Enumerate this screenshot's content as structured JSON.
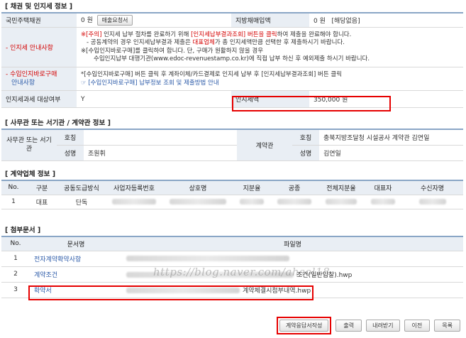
{
  "bond_section": {
    "title": "[ 채권 및 인지세 정보 ]",
    "housing_bond_label": "국민주택채권",
    "housing_bond_value": "0 원",
    "purchase_btn": "매출요청서",
    "local_bond_label": "지방채매입액",
    "local_bond_value": "0 원   [해당없음]",
    "stamp_guide_label": "- 인지세 안내사항",
    "guide_line1_prefix": "※[주의] ",
    "guide_line1_a": "인지세 납부 절차를 완료하기 위해 ",
    "guide_line1_red": "[인지세납부결과조회] 버튼을 클릭",
    "guide_line1_b": "하여 제출을 완료해야 합니다.",
    "guide_line2_a": "- 공동계약의 경우 인지세납부결과 제출은 ",
    "guide_line2_red": "대표업체",
    "guide_line2_b": "가 총 인지세액만큼 선택한 후 제출하시기 바랍니다.",
    "guide_line3": "※[수입인지바로구매]를 클릭하여 합니다. 단, 구매가 원활하지 않을 경우",
    "guide_line4": "수입인지납부 대행기관(www.edoc-revenuestamp.co.kr)에 직접 납부 하신 후 예외제출 하시기 바랍니다.",
    "buy_label_1": "- 수입인지바로구매",
    "buy_label_2": "안내사항",
    "buy_line1": "*[수입인지바로구매] 버튼 클릭 후 계좌이체/카드결제로 인지세 납부 후 [인지세납부결과조회] 버튼 클릭",
    "buy_line2": "[수입인지바로구매] 납부정보 조회 및 제출방법 안내",
    "target_label": "인지세과세 대상여부",
    "target_value": "Y",
    "amount_label": "인지세액",
    "amount_value": "350,000 원"
  },
  "office_section": {
    "title": "[ 사무관 또는 서기관 / 계약관 정보 ]",
    "officer_label": "사무관 또는 서기관",
    "name_label": "호칭",
    "person_label": "성명",
    "officer_name": "조원휘",
    "contractor_label": "계약관",
    "contractor_title": "충북지방조달청 시설공사 계약관 김연일",
    "contractor_name": "김연일"
  },
  "company_section": {
    "title": "[ 계약업체 정보 ]",
    "headers": [
      "No.",
      "구분",
      "공동도급방식",
      "사업자등록번호",
      "상호명",
      "지분율",
      "공종",
      "전체지분율",
      "대표자",
      "수신자명"
    ],
    "row": {
      "no": "1",
      "type": "대표",
      "method": "단독"
    }
  },
  "attach_section": {
    "title": "[ 첨부문서 ]",
    "headers": [
      "No.",
      "문서명",
      "파일명"
    ],
    "rows": [
      {
        "no": "1",
        "doc": "전자계약확약사항",
        "file": ""
      },
      {
        "no": "2",
        "doc": "계약조건",
        "file": "조건(일반입찰).hwp"
      },
      {
        "no": "3",
        "doc": "확약서",
        "file": "계약체결시첨부내역.hwp"
      }
    ]
  },
  "watermark": "https://blog.naver.com/ahsol18",
  "buttons": {
    "apply": "계약응답서작성",
    "print": "출력",
    "download": "내려받기",
    "prev": "이전",
    "list": "목록"
  },
  "colors": {
    "header_bg": "#e9eef4",
    "table_rule": "#8aa6c6",
    "highlight": "#e60000",
    "link": "#2b5aa8"
  }
}
